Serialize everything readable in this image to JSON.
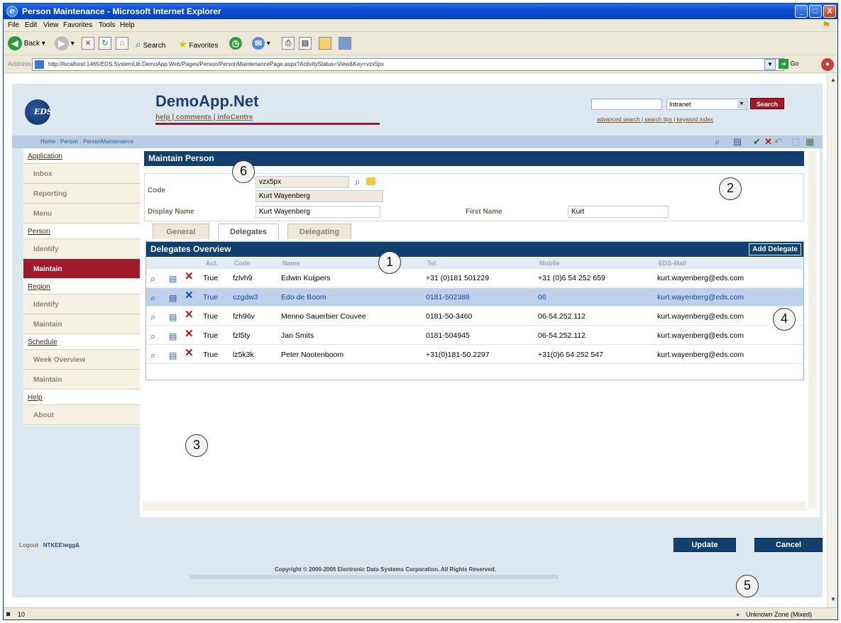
{
  "window": {
    "title": "Person Maintenance - Microsoft Internet Explorer",
    "controls": [
      "_",
      "□",
      "X"
    ]
  },
  "menu": [
    "File",
    "Edit",
    "View",
    "Favorites",
    "Tools",
    "Help"
  ],
  "toolbar": {
    "back": "Back",
    "search": "Search",
    "favorites": "Favorites"
  },
  "address": {
    "label": "Address",
    "url": "http://localhost:1465/EDS.SystemLib.DemoApp.Web/Pages/Person/PersonMaintenancePage.aspx?ActivityStatus=View&Key=vzx5px",
    "go": "Go"
  },
  "app": {
    "logo": "EDS",
    "title": "DemoApp.Net",
    "links": "help | comments | infoCentre",
    "search_select": "Intranet",
    "search_button": "Search",
    "search_links": "advanced search | search tips | keyword index"
  },
  "breadcrumb": "Home : Person : PersonMaintenance",
  "nav": [
    {
      "label": "Application",
      "level": "top"
    },
    {
      "label": "Inbox",
      "level": "sub"
    },
    {
      "label": "Reporting",
      "level": "sub"
    },
    {
      "label": "Menu",
      "level": "sub"
    },
    {
      "label": "Person",
      "level": "top"
    },
    {
      "label": "Identify",
      "level": "sub"
    },
    {
      "label": "Maintain",
      "level": "sub",
      "selected": true
    },
    {
      "label": "Region",
      "level": "top"
    },
    {
      "label": "Identify",
      "level": "sub"
    },
    {
      "label": "Maintain",
      "level": "sub"
    },
    {
      "label": "Schedule",
      "level": "top"
    },
    {
      "label": "Week Overview",
      "level": "sub"
    },
    {
      "label": "Maintain",
      "level": "sub"
    },
    {
      "label": "Help",
      "level": "top"
    },
    {
      "label": "About",
      "level": "sub"
    }
  ],
  "main": {
    "title": "Maintain Person",
    "form": {
      "code_label": "Code",
      "code_value": "vzx5px",
      "code_name": "Kurt Wayenberg",
      "display_name_label": "Display Name",
      "display_name_value": "Kurt Wayenberg",
      "first_name_label": "First Name",
      "first_name_value": "Kurt"
    },
    "tabs": [
      "General",
      "Delegates",
      "Delegating"
    ],
    "active_tab": "Delegates"
  },
  "delegates": {
    "title": "Delegates Overview",
    "add_button": "Add Delegate",
    "columns": [
      "Act.",
      "Code",
      "Name",
      "Tel.",
      "Mobile",
      "EDS-Mail"
    ],
    "rows": [
      {
        "act": "True",
        "code": "fzlvh9",
        "name": "Edwin Kuijpers",
        "tel": "+31 (0)181 501229",
        "mobile": "+31 (0)6 54 252 659",
        "mail": "kurt.wayenberg@eds.com"
      },
      {
        "act": "True",
        "code": "czgdw3",
        "name": "Edo de Boom",
        "tel": "0181-502388",
        "mobile": "06",
        "mail": "kurt.wayenberg@eds.com",
        "selected": true
      },
      {
        "act": "True",
        "code": "fzh96v",
        "name": "Menno Sauerbier Couvee",
        "tel": "0181-50-3460",
        "mobile": "06-54.252.112",
        "mail": "kurt.wayenberg@eds.com"
      },
      {
        "act": "True",
        "code": "fzl5ty",
        "name": "Jan Smits",
        "tel": "0181-504945",
        "mobile": "06-54.252.112",
        "mail": "kurt.wayenberg@eds.com"
      },
      {
        "act": "True",
        "code": "lz5k3k",
        "name": "Peter Nootenboom",
        "tel": "+31(0)181-50.2297",
        "mobile": "+31(0)6 54 252 547",
        "mail": "kurt.wayenberg@eds.com"
      }
    ]
  },
  "footer": {
    "logout": "Logout",
    "user": "NTKEE\\wgg&",
    "update": "Update",
    "cancel": "Cancel",
    "copyright": "Copyright © 2000-2005 Electronic Data Systems Corporation. All Rights Reserved."
  },
  "callouts": [
    "1",
    "2",
    "3",
    "4",
    "5",
    "6"
  ],
  "status": {
    "left": "10",
    "zone": "Unknown Zone (Mixed)"
  },
  "colors": {
    "xp_title": "#0b4cd4",
    "header_navy": "#11406e",
    "accent_red": "#a11a2b",
    "page_bg": "#dde7f0",
    "selected_row": "#bdd2ea"
  }
}
